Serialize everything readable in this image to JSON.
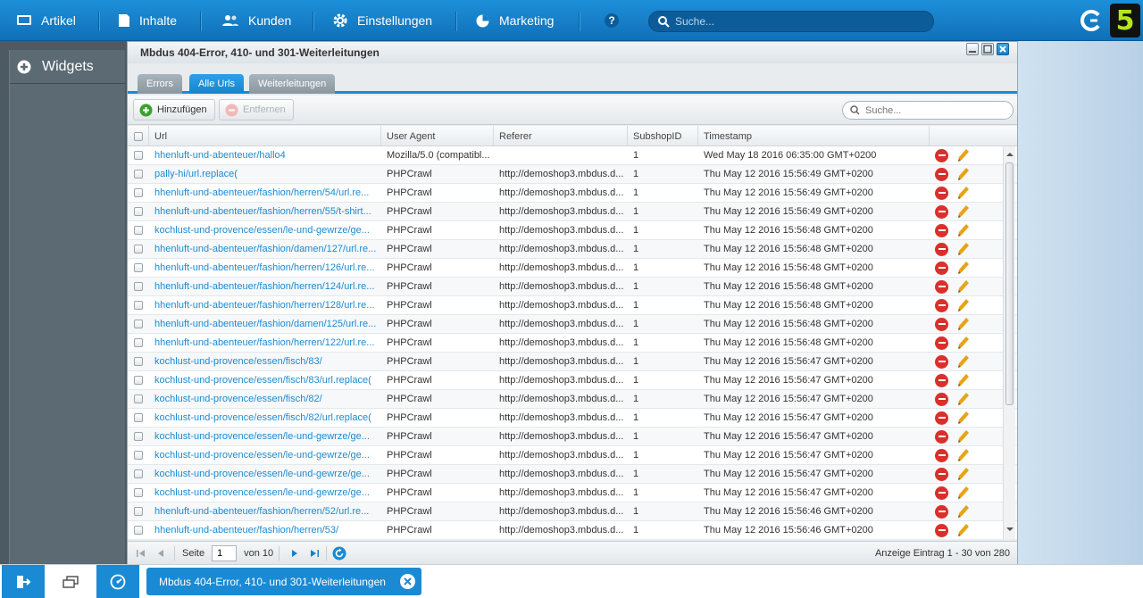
{
  "topnav": {
    "items": [
      {
        "label": "Artikel",
        "icon": "monitor-icon"
      },
      {
        "label": "Inhalte",
        "icon": "document-icon"
      },
      {
        "label": "Kunden",
        "icon": "users-icon"
      },
      {
        "label": "Einstellungen",
        "icon": "gear-icon"
      },
      {
        "label": "Marketing",
        "icon": "pie-chart-icon"
      }
    ],
    "help_icon": "help-icon",
    "search_placeholder": "Suche...",
    "logo_text": "5"
  },
  "sidebar": {
    "widgets_label": "Widgets"
  },
  "window": {
    "title": "Mbdus 404-Error, 410- und 301-Weiterleitungen",
    "tabs": [
      {
        "label": "Errors",
        "active": false
      },
      {
        "label": "Alle Urls",
        "active": true
      },
      {
        "label": "Weiterleitungen",
        "active": false
      }
    ],
    "toolbar": {
      "add_label": "Hinzufügen",
      "remove_label": "Entfernen",
      "search_placeholder": "Suche..."
    },
    "grid": {
      "columns": [
        "Url",
        "User Agent",
        "Referer",
        "SubshopID",
        "Timestamp"
      ],
      "rows": [
        {
          "url": "hhenluft-und-abenteuer/hallo4",
          "agent": "Mozilla/5.0 (compatibl...",
          "referer": "",
          "shop": "1",
          "ts": "Wed May 18 2016 06:35:00 GMT+0200"
        },
        {
          "url": "pally-hi/url.replace(",
          "agent": "PHPCrawl",
          "referer": "http://demoshop3.mbdus.d...",
          "shop": "1",
          "ts": "Thu May 12 2016 15:56:49 GMT+0200"
        },
        {
          "url": "hhenluft-und-abenteuer/fashion/herren/54/url.re...",
          "agent": "PHPCrawl",
          "referer": "http://demoshop3.mbdus.d...",
          "shop": "1",
          "ts": "Thu May 12 2016 15:56:49 GMT+0200"
        },
        {
          "url": "hhenluft-und-abenteuer/fashion/herren/55/t-shirt...",
          "agent": "PHPCrawl",
          "referer": "http://demoshop3.mbdus.d...",
          "shop": "1",
          "ts": "Thu May 12 2016 15:56:49 GMT+0200"
        },
        {
          "url": "kochlust-und-provence/essen/le-und-gewrze/ge...",
          "agent": "PHPCrawl",
          "referer": "http://demoshop3.mbdus.d...",
          "shop": "1",
          "ts": "Thu May 12 2016 15:56:48 GMT+0200"
        },
        {
          "url": "hhenluft-und-abenteuer/fashion/damen/127/url.re...",
          "agent": "PHPCrawl",
          "referer": "http://demoshop3.mbdus.d...",
          "shop": "1",
          "ts": "Thu May 12 2016 15:56:48 GMT+0200"
        },
        {
          "url": "hhenluft-und-abenteuer/fashion/herren/126/url.re...",
          "agent": "PHPCrawl",
          "referer": "http://demoshop3.mbdus.d...",
          "shop": "1",
          "ts": "Thu May 12 2016 15:56:48 GMT+0200"
        },
        {
          "url": "hhenluft-und-abenteuer/fashion/herren/124/url.re...",
          "agent": "PHPCrawl",
          "referer": "http://demoshop3.mbdus.d...",
          "shop": "1",
          "ts": "Thu May 12 2016 15:56:48 GMT+0200"
        },
        {
          "url": "hhenluft-und-abenteuer/fashion/herren/128/url.re...",
          "agent": "PHPCrawl",
          "referer": "http://demoshop3.mbdus.d...",
          "shop": "1",
          "ts": "Thu May 12 2016 15:56:48 GMT+0200"
        },
        {
          "url": "hhenluft-und-abenteuer/fashion/damen/125/url.re...",
          "agent": "PHPCrawl",
          "referer": "http://demoshop3.mbdus.d...",
          "shop": "1",
          "ts": "Thu May 12 2016 15:56:48 GMT+0200"
        },
        {
          "url": "hhenluft-und-abenteuer/fashion/herren/122/url.re...",
          "agent": "PHPCrawl",
          "referer": "http://demoshop3.mbdus.d...",
          "shop": "1",
          "ts": "Thu May 12 2016 15:56:48 GMT+0200"
        },
        {
          "url": "kochlust-und-provence/essen/fisch/83/",
          "agent": "PHPCrawl",
          "referer": "http://demoshop3.mbdus.d...",
          "shop": "1",
          "ts": "Thu May 12 2016 15:56:47 GMT+0200"
        },
        {
          "url": "kochlust-und-provence/essen/fisch/83/url.replace(",
          "agent": "PHPCrawl",
          "referer": "http://demoshop3.mbdus.d...",
          "shop": "1",
          "ts": "Thu May 12 2016 15:56:47 GMT+0200"
        },
        {
          "url": "kochlust-und-provence/essen/fisch/82/",
          "agent": "PHPCrawl",
          "referer": "http://demoshop3.mbdus.d...",
          "shop": "1",
          "ts": "Thu May 12 2016 15:56:47 GMT+0200"
        },
        {
          "url": "kochlust-und-provence/essen/fisch/82/url.replace(",
          "agent": "PHPCrawl",
          "referer": "http://demoshop3.mbdus.d...",
          "shop": "1",
          "ts": "Thu May 12 2016 15:56:47 GMT+0200"
        },
        {
          "url": "kochlust-und-provence/essen/le-und-gewrze/ge...",
          "agent": "PHPCrawl",
          "referer": "http://demoshop3.mbdus.d...",
          "shop": "1",
          "ts": "Thu May 12 2016 15:56:47 GMT+0200"
        },
        {
          "url": "kochlust-und-provence/essen/le-und-gewrze/ge...",
          "agent": "PHPCrawl",
          "referer": "http://demoshop3.mbdus.d...",
          "shop": "1",
          "ts": "Thu May 12 2016 15:56:47 GMT+0200"
        },
        {
          "url": "kochlust-und-provence/essen/le-und-gewrze/ge...",
          "agent": "PHPCrawl",
          "referer": "http://demoshop3.mbdus.d...",
          "shop": "1",
          "ts": "Thu May 12 2016 15:56:47 GMT+0200"
        },
        {
          "url": "kochlust-und-provence/essen/le-und-gewrze/ge...",
          "agent": "PHPCrawl",
          "referer": "http://demoshop3.mbdus.d...",
          "shop": "1",
          "ts": "Thu May 12 2016 15:56:47 GMT+0200"
        },
        {
          "url": "hhenluft-und-abenteuer/fashion/herren/52/url.re...",
          "agent": "PHPCrawl",
          "referer": "http://demoshop3.mbdus.d...",
          "shop": "1",
          "ts": "Thu May 12 2016 15:56:46 GMT+0200"
        },
        {
          "url": "hhenluft-und-abenteuer/fashion/herren/53/",
          "agent": "PHPCrawl",
          "referer": "http://demoshop3.mbdus.d...",
          "shop": "1",
          "ts": "Thu May 12 2016 15:56:46 GMT+0200"
        }
      ]
    },
    "pager": {
      "page_label": "Seite",
      "page_value": "1",
      "of_label": "von 10",
      "display_info": "Anzeige Eintrag 1 - 30 von 280"
    }
  },
  "taskbar": {
    "task_label": "Mbdus 404-Error, 410- und 301-Weiterleitungen"
  },
  "colors": {
    "accent": "#1a8ad4",
    "link": "#1d8ad1",
    "delete": "#d9302c",
    "edit": "#e8a317",
    "logo": "#b5e61d"
  }
}
